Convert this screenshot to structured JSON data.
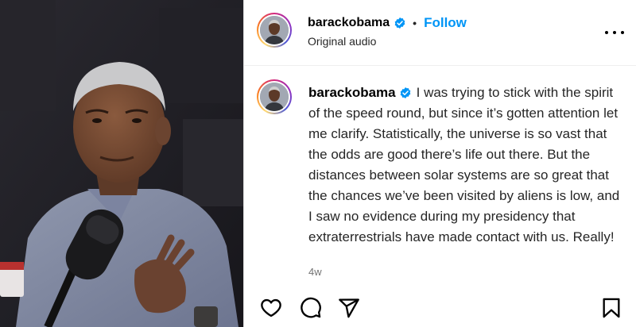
{
  "post": {
    "username": "barackobama",
    "verified": true,
    "separator": "•",
    "follow_label": "Follow",
    "audio_label": "Original audio",
    "caption": {
      "username": "barackobama",
      "text": "I was trying to stick with the spirit of the speed round, but since it’s gotten attention let me clarify. Statistically, the universe is so vast that the odds are good there’s life out there. But the distances between solar systems are so great that the chances we’ve been visited by aliens is low, and I saw no evidence during my presidency that extraterrestrials have made contact with us. Really!"
    },
    "timestamp": "4w"
  },
  "icons": {
    "verified": "verified-badge-icon",
    "more": "more-options-icon",
    "like": "heart-icon",
    "comment": "comment-bubble-icon",
    "share": "paper-plane-icon",
    "save": "bookmark-icon"
  },
  "colors": {
    "follow_blue": "#0095f6",
    "verified_blue": "#0095f6",
    "text_primary": "#000000",
    "text_secondary": "#737373",
    "divider": "#dbdbdb"
  }
}
